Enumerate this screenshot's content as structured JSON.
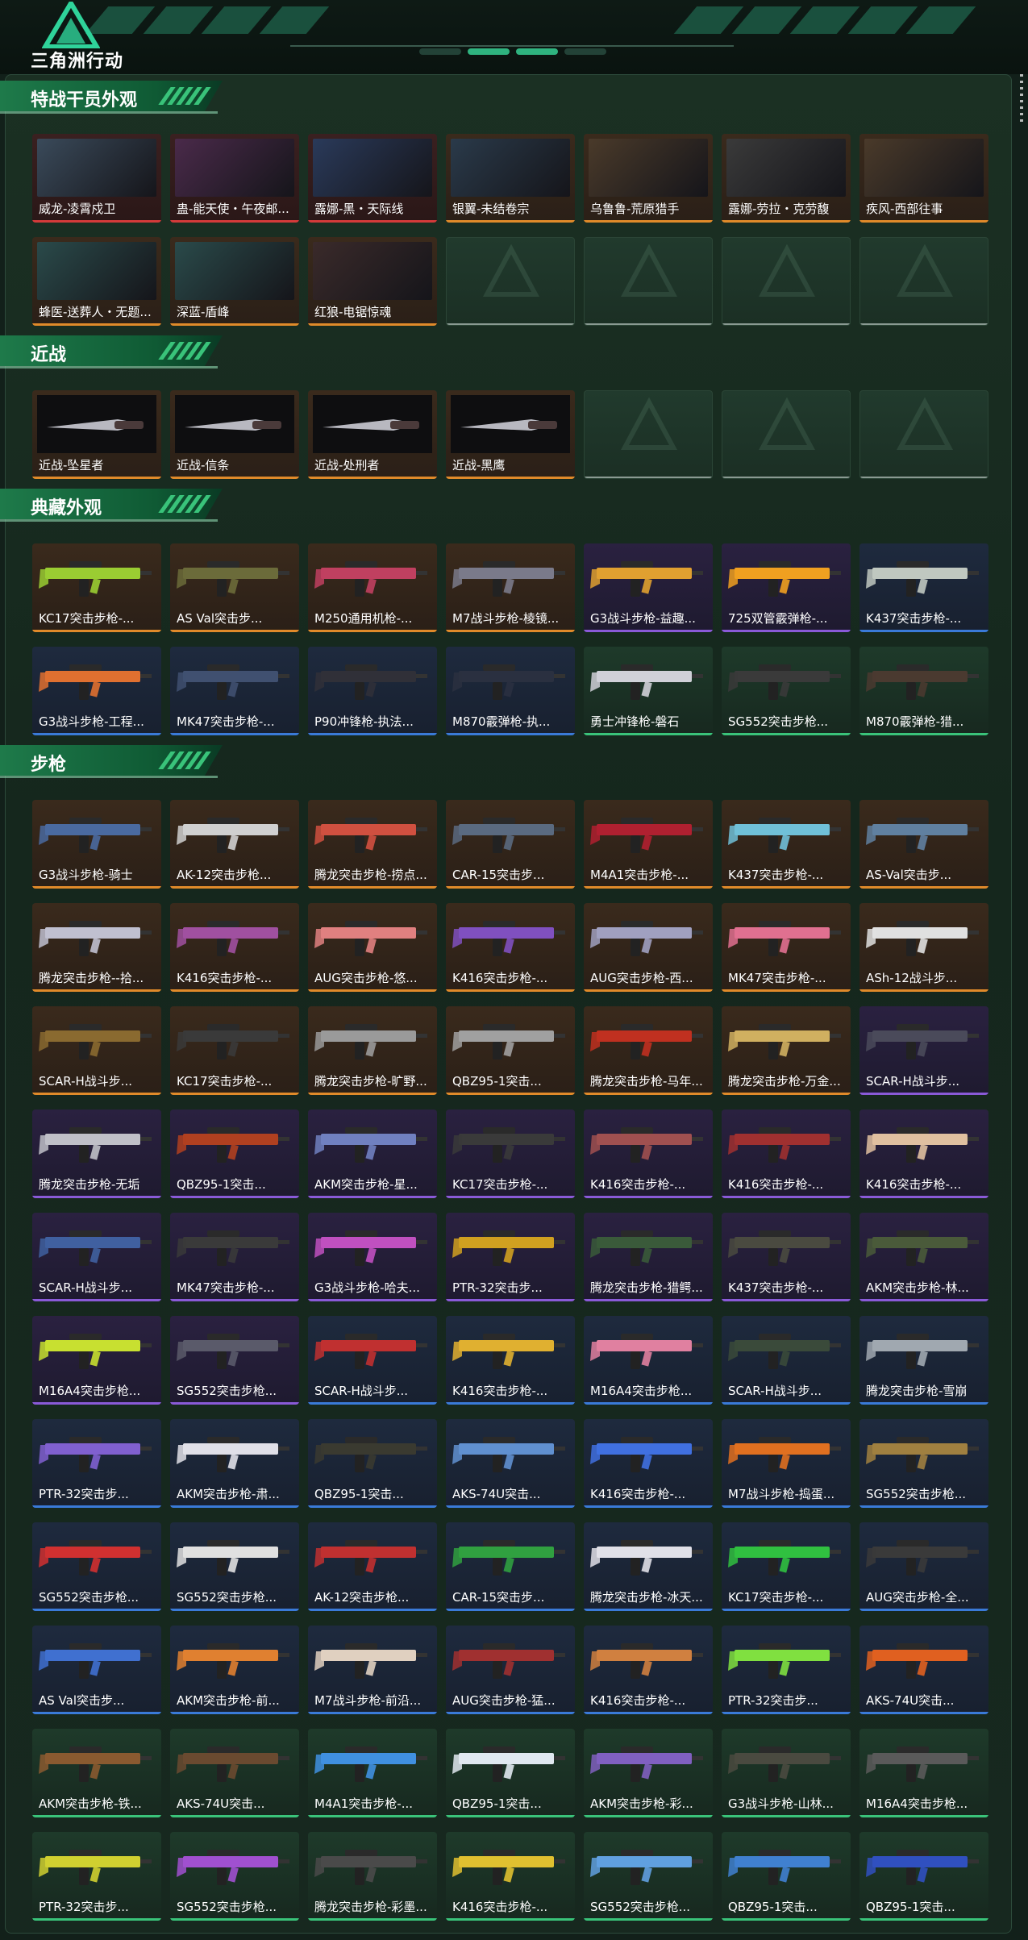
{
  "app": {
    "logo_text": "三角洲行动"
  },
  "sections": [
    {
      "title": "特战干员外观",
      "items": [
        {
          "label": "威龙-凌霄戍卫",
          "rarity": "red",
          "kind": "operator"
        },
        {
          "label": "蛊-能天使・午夜邮...",
          "rarity": "red",
          "kind": "operator"
        },
        {
          "label": "露娜-黑・天际线",
          "rarity": "red",
          "kind": "operator"
        },
        {
          "label": "银翼-未结卷宗",
          "rarity": "gold",
          "kind": "operator"
        },
        {
          "label": "乌鲁鲁-荒原猎手",
          "rarity": "gold",
          "kind": "operator"
        },
        {
          "label": "露娜-劳拉・克劳馥",
          "rarity": "gold",
          "kind": "operator"
        },
        {
          "label": "疾风-西部往事",
          "rarity": "gold",
          "kind": "operator"
        },
        {
          "label": "蜂医-送葬人・无题...",
          "rarity": "gold",
          "kind": "operator"
        },
        {
          "label": "深蓝-盾峰",
          "rarity": "gold",
          "kind": "operator"
        },
        {
          "label": "红狼-电锯惊魂",
          "rarity": "gold",
          "kind": "operator"
        },
        {
          "label": "",
          "rarity": "empty",
          "kind": "empty"
        },
        {
          "label": "",
          "rarity": "empty",
          "kind": "empty"
        },
        {
          "label": "",
          "rarity": "empty",
          "kind": "empty"
        },
        {
          "label": "",
          "rarity": "empty",
          "kind": "empty"
        }
      ]
    },
    {
      "title": "近战",
      "items": [
        {
          "label": "近战-坠星者",
          "rarity": "gold",
          "kind": "knife"
        },
        {
          "label": "近战-信条",
          "rarity": "gold",
          "kind": "knife"
        },
        {
          "label": "近战-处刑者",
          "rarity": "gold",
          "kind": "knife"
        },
        {
          "label": "近战-黑鹰",
          "rarity": "gold",
          "kind": "knife"
        },
        {
          "label": "",
          "rarity": "empty",
          "kind": "empty"
        },
        {
          "label": "",
          "rarity": "empty",
          "kind": "empty"
        },
        {
          "label": "",
          "rarity": "empty",
          "kind": "empty"
        }
      ]
    },
    {
      "title": "典藏外观",
      "items": [
        {
          "label": "KC17突击步枪-...",
          "rarity": "gold",
          "kind": "gun",
          "color": "#9acd32"
        },
        {
          "label": "AS Val突击步...",
          "rarity": "gold",
          "kind": "gun",
          "color": "#6b6b3a"
        },
        {
          "label": "M250通用机枪-...",
          "rarity": "gold",
          "kind": "gun",
          "color": "#c04060"
        },
        {
          "label": "M7战斗步枪-棱镜...",
          "rarity": "gold",
          "kind": "gun",
          "color": "#7a7a8a"
        },
        {
          "label": "G3战斗步枪-益趣...",
          "rarity": "purple",
          "kind": "gun",
          "color": "#e0a030"
        },
        {
          "label": "725双管霰弹枪-...",
          "rarity": "purple",
          "kind": "gun",
          "color": "#f0a020"
        },
        {
          "label": "K437突击步枪-...",
          "rarity": "blue",
          "kind": "gun",
          "color": "#c0c8c0"
        },
        {
          "label": "G3战斗步枪-工程...",
          "rarity": "blue",
          "kind": "gun",
          "color": "#e07030"
        },
        {
          "label": "MK47突击步枪-...",
          "rarity": "blue",
          "kind": "gun",
          "color": "#405070"
        },
        {
          "label": "P90冲锋枪-执法...",
          "rarity": "blue",
          "kind": "gun",
          "color": "#303038"
        },
        {
          "label": "M870霰弹枪-执...",
          "rarity": "blue",
          "kind": "gun",
          "color": "#2a3040"
        },
        {
          "label": "勇士冲锋枪-磐石",
          "rarity": "green",
          "kind": "gun",
          "color": "#d0d0d8"
        },
        {
          "label": "SG552突击步枪...",
          "rarity": "green",
          "kind": "gun",
          "color": "#3a3a3a"
        },
        {
          "label": "M870霰弹枪-猎...",
          "rarity": "green",
          "kind": "gun",
          "color": "#4a3a30"
        }
      ]
    },
    {
      "title": "步枪",
      "items": [
        {
          "label": "G3战斗步枪-骑士",
          "rarity": "gold",
          "kind": "gun",
          "color": "#4a6aa0"
        },
        {
          "label": "AK-12突击步枪...",
          "rarity": "gold",
          "kind": "gun",
          "color": "#d0d0d0"
        },
        {
          "label": "腾龙突击步枪-捞点...",
          "rarity": "gold",
          "kind": "gun",
          "color": "#d05040"
        },
        {
          "label": "CAR-15突击步...",
          "rarity": "gold",
          "kind": "gun",
          "color": "#5a6a80"
        },
        {
          "label": "M4A1突击步枪-...",
          "rarity": "gold",
          "kind": "gun",
          "color": "#b02030"
        },
        {
          "label": "K437突击步枪-...",
          "rarity": "gold",
          "kind": "gun",
          "color": "#70c0d8"
        },
        {
          "label": "AS-Val突击步...",
          "rarity": "gold",
          "kind": "gun",
          "color": "#6080a0"
        },
        {
          "label": "腾龙突击步枪--拾...",
          "rarity": "gold",
          "kind": "gun",
          "color": "#c0c0d0"
        },
        {
          "label": "K416突击步枪-...",
          "rarity": "gold",
          "kind": "gun",
          "color": "#a050a0"
        },
        {
          "label": "AUG突击步枪-悠...",
          "rarity": "gold",
          "kind": "gun",
          "color": "#e08080"
        },
        {
          "label": "K416突击步枪-...",
          "rarity": "gold",
          "kind": "gun",
          "color": "#8050c0"
        },
        {
          "label": "AUG突击步枪-西...",
          "rarity": "gold",
          "kind": "gun",
          "color": "#a0a0c0"
        },
        {
          "label": "MK47突击步枪-...",
          "rarity": "gold",
          "kind": "gun",
          "color": "#e07090"
        },
        {
          "label": "ASh-12战斗步...",
          "rarity": "gold",
          "kind": "gun",
          "color": "#e0e0e0"
        },
        {
          "label": "SCAR-H战斗步...",
          "rarity": "gold",
          "kind": "gun",
          "color": "#8a6a30"
        },
        {
          "label": "KC17突击步枪-...",
          "rarity": "gold",
          "kind": "gun",
          "color": "#3a3a3a"
        },
        {
          "label": "腾龙突击步枪-旷野...",
          "rarity": "gold",
          "kind": "gun",
          "color": "#9a9a9a"
        },
        {
          "label": "QBZ95-1突击...",
          "rarity": "gold",
          "kind": "gun",
          "color": "#a0a0a0"
        },
        {
          "label": "腾龙突击步枪-马年...",
          "rarity": "gold",
          "kind": "gun",
          "color": "#c03020"
        },
        {
          "label": "腾龙突击步枪-万金...",
          "rarity": "gold",
          "kind": "gun",
          "color": "#d0b060"
        },
        {
          "label": "SCAR-H战斗步...",
          "rarity": "purple",
          "kind": "gun",
          "color": "#4a4a5a"
        },
        {
          "label": "腾龙突击步枪-无垢",
          "rarity": "purple",
          "kind": "gun",
          "color": "#c0c0c8"
        },
        {
          "label": "QBZ95-1突击...",
          "rarity": "purple",
          "kind": "gun",
          "color": "#b04020"
        },
        {
          "label": "AKM突击步枪-星...",
          "rarity": "purple",
          "kind": "gun",
          "color": "#7080c0"
        },
        {
          "label": "KC17突击步枪-...",
          "rarity": "purple",
          "kind": "gun",
          "color": "#3a3a3a"
        },
        {
          "label": "K416突击步枪-...",
          "rarity": "purple",
          "kind": "gun",
          "color": "#a05050"
        },
        {
          "label": "K416突击步枪-...",
          "rarity": "purple",
          "kind": "gun",
          "color": "#a03030"
        },
        {
          "label": "K416突击步枪-...",
          "rarity": "purple",
          "kind": "gun",
          "color": "#e0c0a0"
        },
        {
          "label": "SCAR-H战斗步...",
          "rarity": "purple",
          "kind": "gun",
          "color": "#4060a0"
        },
        {
          "label": "MK47突击步枪-...",
          "rarity": "purple",
          "kind": "gun",
          "color": "#3a3a3a"
        },
        {
          "label": "G3战斗步枪-哈夫...",
          "rarity": "purple",
          "kind": "gun",
          "color": "#c050c0"
        },
        {
          "label": "PTR-32突击步...",
          "rarity": "purple",
          "kind": "gun",
          "color": "#d0a020"
        },
        {
          "label": "腾龙突击步枪-猎鳄...",
          "rarity": "purple",
          "kind": "gun",
          "color": "#3a5a3a"
        },
        {
          "label": "K437突击步枪-...",
          "rarity": "purple",
          "kind": "gun",
          "color": "#4a4a40"
        },
        {
          "label": "AKM突击步枪-林...",
          "rarity": "purple",
          "kind": "gun",
          "color": "#4a5a3a"
        },
        {
          "label": "M16A4突击步枪...",
          "rarity": "purple",
          "kind": "gun",
          "color": "#c8e030"
        },
        {
          "label": "SG552突击步枪...",
          "rarity": "purple",
          "kind": "gun",
          "color": "#5a5a6a"
        },
        {
          "label": "SCAR-H战斗步...",
          "rarity": "blue",
          "kind": "gun",
          "color": "#c03030"
        },
        {
          "label": "K416突击步枪-...",
          "rarity": "blue",
          "kind": "gun",
          "color": "#e0b030"
        },
        {
          "label": "M16A4突击步枪...",
          "rarity": "blue",
          "kind": "gun",
          "color": "#e080a0"
        },
        {
          "label": "SCAR-H战斗步...",
          "rarity": "blue",
          "kind": "gun",
          "color": "#3a4a3a"
        },
        {
          "label": "腾龙突击步枪-雪崩",
          "rarity": "blue",
          "kind": "gun",
          "color": "#a0a8b0"
        },
        {
          "label": "PTR-32突击步...",
          "rarity": "blue",
          "kind": "gun",
          "color": "#8060d0"
        },
        {
          "label": "AKM突击步枪-肃...",
          "rarity": "blue",
          "kind": "gun",
          "color": "#e0e0e8"
        },
        {
          "label": "QBZ95-1突击...",
          "rarity": "blue",
          "kind": "gun",
          "color": "#3a3a30"
        },
        {
          "label": "AKS-74U突击...",
          "rarity": "blue",
          "kind": "gun",
          "color": "#6090d0"
        },
        {
          "label": "K416突击步枪-...",
          "rarity": "blue",
          "kind": "gun",
          "color": "#4070e0"
        },
        {
          "label": "M7战斗步枪-捣蛋...",
          "rarity": "blue",
          "kind": "gun",
          "color": "#e07020"
        },
        {
          "label": "SG552突击步枪...",
          "rarity": "blue",
          "kind": "gun",
          "color": "#a08040"
        },
        {
          "label": "SG552突击步枪...",
          "rarity": "blue",
          "kind": "gun",
          "color": "#d03030"
        },
        {
          "label": "SG552突击步枪...",
          "rarity": "blue",
          "kind": "gun",
          "color": "#e0e0e0"
        },
        {
          "label": "AK-12突击步枪...",
          "rarity": "blue",
          "kind": "gun",
          "color": "#c03030"
        },
        {
          "label": "CAR-15突击步...",
          "rarity": "blue",
          "kind": "gun",
          "color": "#30a040"
        },
        {
          "label": "腾龙突击步枪-冰天...",
          "rarity": "blue",
          "kind": "gun",
          "color": "#e0e0e8"
        },
        {
          "label": "KC17突击步枪-...",
          "rarity": "blue",
          "kind": "gun",
          "color": "#30c040"
        },
        {
          "label": "AUG突击步枪-全...",
          "rarity": "blue",
          "kind": "gun",
          "color": "#3a3a3a"
        },
        {
          "label": "AS Val突击步...",
          "rarity": "blue",
          "kind": "gun",
          "color": "#4070d0"
        },
        {
          "label": "AKM突击步枪-前...",
          "rarity": "blue",
          "kind": "gun",
          "color": "#e08030"
        },
        {
          "label": "M7战斗步枪-前沿...",
          "rarity": "blue",
          "kind": "gun",
          "color": "#e0d0c0"
        },
        {
          "label": "AUG突击步枪-猛...",
          "rarity": "blue",
          "kind": "gun",
          "color": "#a03030"
        },
        {
          "label": "K416突击步枪-...",
          "rarity": "blue",
          "kind": "gun",
          "color": "#d08040"
        },
        {
          "label": "PTR-32突击步...",
          "rarity": "blue",
          "kind": "gun",
          "color": "#80e040"
        },
        {
          "label": "AKS-74U突击...",
          "rarity": "blue",
          "kind": "gun",
          "color": "#e06020"
        },
        {
          "label": "AKM突击步枪-铁...",
          "rarity": "green",
          "kind": "gun",
          "color": "#8a5a30"
        },
        {
          "label": "AKS-74U突击...",
          "rarity": "green",
          "kind": "gun",
          "color": "#6a4a30"
        },
        {
          "label": "M4A1突击步枪-...",
          "rarity": "green",
          "kind": "gun",
          "color": "#4090e0"
        },
        {
          "label": "QBZ95-1突击...",
          "rarity": "green",
          "kind": "gun",
          "color": "#e0e8f0"
        },
        {
          "label": "AKM突击步枪-彩...",
          "rarity": "green",
          "kind": "gun",
          "color": "#8060c0"
        },
        {
          "label": "G3战斗步枪-山林...",
          "rarity": "green",
          "kind": "gun",
          "color": "#4a4a40"
        },
        {
          "label": "M16A4突击步枪...",
          "rarity": "green",
          "kind": "gun",
          "color": "#5a5a5a"
        },
        {
          "label": "PTR-32突击步...",
          "rarity": "green",
          "kind": "gun",
          "color": "#d0d030"
        },
        {
          "label": "SG552突击步枪...",
          "rarity": "green",
          "kind": "gun",
          "color": "#a050d0"
        },
        {
          "label": "腾龙突击步枪-彩墨...",
          "rarity": "green",
          "kind": "gun",
          "color": "#4a4a4a"
        },
        {
          "label": "K416突击步枪-...",
          "rarity": "green",
          "kind": "gun",
          "color": "#e0c030"
        },
        {
          "label": "SG552突击步枪...",
          "rarity": "green",
          "kind": "gun",
          "color": "#60a0e0"
        },
        {
          "label": "QBZ95-1突击...",
          "rarity": "green",
          "kind": "gun",
          "color": "#4080d0"
        },
        {
          "label": "QBZ95-1突击...",
          "rarity": "green",
          "kind": "gun",
          "color": "#3050c0"
        }
      ]
    }
  ]
}
